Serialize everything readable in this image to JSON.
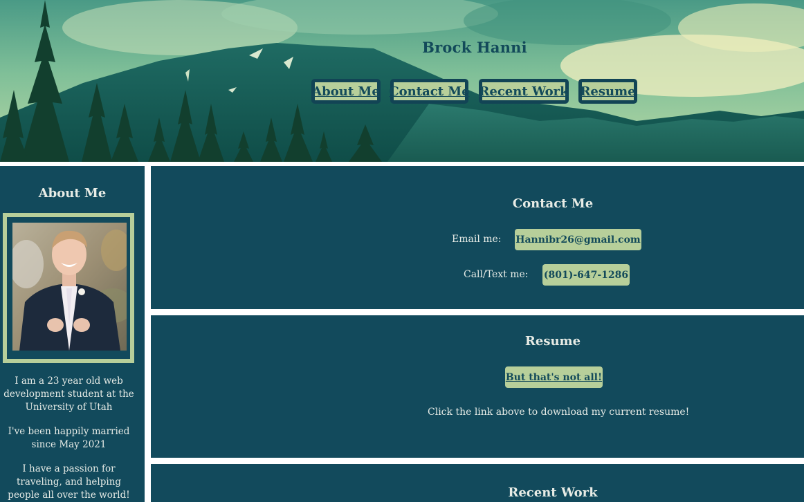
{
  "header": {
    "site_title": "Brock Hanni",
    "nav": [
      {
        "label": "About Me"
      },
      {
        "label": "Contact Me"
      },
      {
        "label": "Recent Work"
      },
      {
        "label": "Resume"
      }
    ]
  },
  "sidebar": {
    "heading": "About Me",
    "bio": [
      "I am a 23 year old web development student at the University of Utah",
      "I've been happily married since May 2021",
      "I have a passion for traveling, and helping people all over the world!"
    ]
  },
  "contact": {
    "heading": "Contact Me",
    "email_label": "Email me:",
    "email_value": "Hannibr26@gmail.com",
    "phone_label": "Call/Text me:",
    "phone_value": "(801)-647-1286"
  },
  "resume": {
    "heading": "Resume",
    "link_label": "But that's not all!",
    "description": "Click the link above to download my current resume!"
  },
  "recent_work": {
    "heading": "Recent Work"
  },
  "colors": {
    "panel": "#124a5c",
    "accent": "#b7cf9a",
    "text_dark": "#134a5a"
  }
}
